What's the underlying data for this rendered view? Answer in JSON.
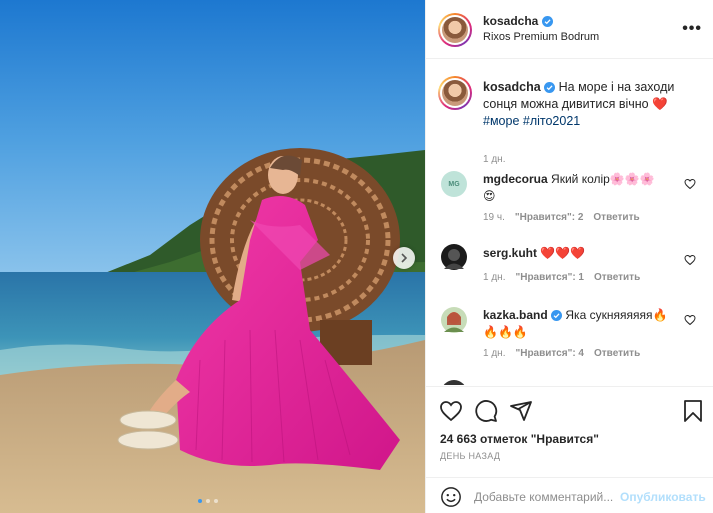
{
  "post": {
    "username": "kosadcha",
    "location": "Rixos Premium Bodrum",
    "caption_text": "На море і на заходи сонця можна дивитися вічно",
    "caption_emoji": "❤️",
    "hashtags": "#море #літо2021",
    "caption_time": "1 дн."
  },
  "comments": [
    {
      "username": "mgdecorua",
      "text": "Який колір🌸🌸🌸",
      "text2": "😍",
      "time": "19 ч.",
      "likes": "\"Нравится\": 2",
      "reply": "Ответить",
      "avatar_text": "MG"
    },
    {
      "username": "serg.kuht",
      "text": "❤️❤️❤️",
      "time": "1 дн.",
      "likes": "\"Нравится\": 1",
      "reply": "Ответить"
    },
    {
      "username": "kazka.band",
      "text": "Яка сукняяяяяя🔥",
      "text2": "🔥🔥🔥",
      "time": "1 дн.",
      "likes": "\"Нравится\": 4",
      "reply": "Ответить"
    }
  ],
  "likes_count": "24 663 отметок \"Нравится\"",
  "date_label": "ДЕНЬ НАЗАД",
  "add_comment": {
    "placeholder": "Добавьте комментарий...",
    "post_label": "Опубликовать"
  },
  "icons": {
    "verified": "verified-badge-icon",
    "more": "more-options-icon",
    "like": "heart-icon",
    "comment": "comment-icon",
    "share": "send-icon",
    "save": "bookmark-icon",
    "emoji": "emoji-icon",
    "next": "chevron-right-icon"
  },
  "colors": {
    "accent": "#0095f6",
    "link": "#00376b",
    "muted": "#8e8e8e",
    "verified": "#3897f0"
  },
  "carousel": {
    "current": 1,
    "total": 3
  }
}
